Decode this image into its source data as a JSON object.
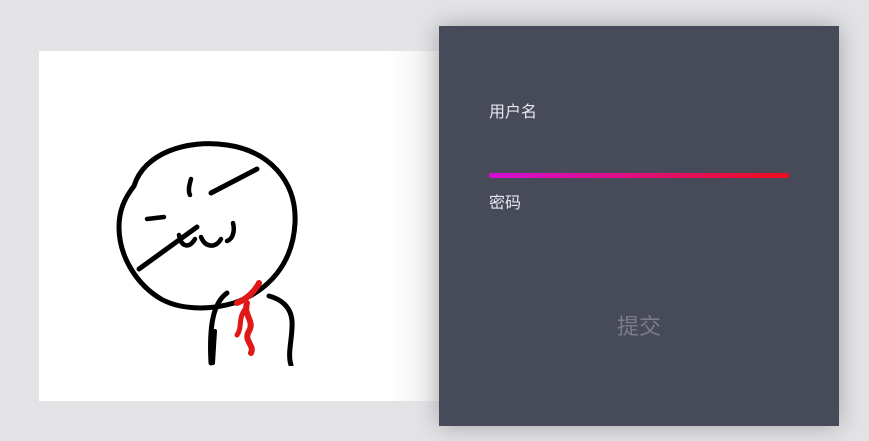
{
  "form": {
    "username_label": "用户名",
    "username_value": "",
    "password_label": "密码",
    "password_value": "",
    "submit_label": "提交"
  },
  "colors": {
    "page_background": "#e3e3e6",
    "panel_background": "#474a59",
    "underline_gradient_start": "#d40fd6",
    "underline_gradient_end": "#ee0d1c",
    "label_text": "#e6e6ec",
    "submit_text": "#7a7c88",
    "scarf": "#e01818"
  },
  "image": {
    "content": "doodle-character-with-red-scarf"
  }
}
